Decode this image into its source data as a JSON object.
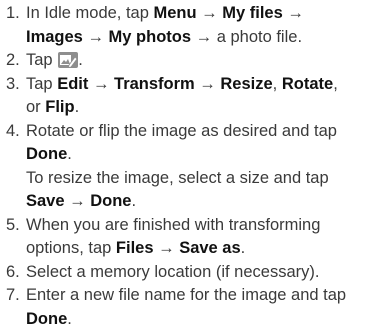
{
  "steps": [
    {
      "number": "1.",
      "lines": [
        [
          "In Idle mode, tap ",
          "Menu",
          " → ",
          "My files",
          " →"
        ],
        [
          "Images",
          " → ",
          "My photos",
          " → a photo file."
        ]
      ]
    },
    {
      "number": "2.",
      "text_before": "Tap ",
      "icon": "edit-image-icon",
      "text_after": "."
    },
    {
      "number": "3.",
      "lines": [
        [
          "Tap ",
          "Edit",
          " → ",
          "Transform",
          " → ",
          "Resize",
          ", ",
          "Rotate",
          ","
        ],
        [
          "or ",
          "Flip",
          "."
        ]
      ]
    },
    {
      "number": "4.",
      "lines": [
        [
          "Rotate or flip the image as desired and tap"
        ],
        [
          "Done",
          "."
        ]
      ],
      "sub_lines": [
        [
          "To resize the image, select a size and tap"
        ],
        [
          "Save",
          " → ",
          "Done",
          "."
        ]
      ]
    },
    {
      "number": "5.",
      "lines": [
        [
          "When you are finished with transforming"
        ],
        [
          "options, tap ",
          "Files",
          " → ",
          "Save as",
          "."
        ]
      ]
    },
    {
      "number": "6.",
      "lines": [
        [
          "Select a memory location (if necessary)."
        ]
      ]
    },
    {
      "number": "7.",
      "lines": [
        [
          "Enter a new file name for the image and tap"
        ],
        [
          "Done",
          "."
        ]
      ]
    }
  ]
}
